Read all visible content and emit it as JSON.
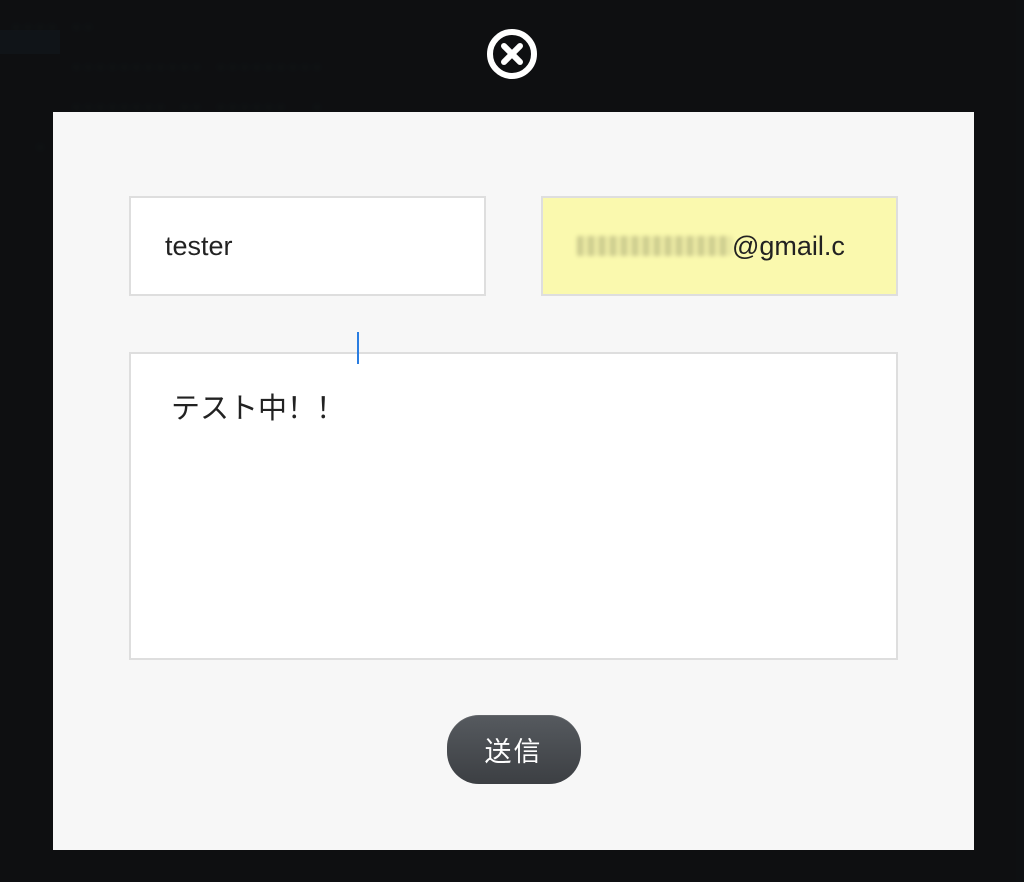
{
  "modal": {
    "close_icon": "close-circle",
    "name_value": "tester",
    "email_visible_suffix": "@gmail.c",
    "message_value": "テスト中！！",
    "submit_label": "送信"
  }
}
